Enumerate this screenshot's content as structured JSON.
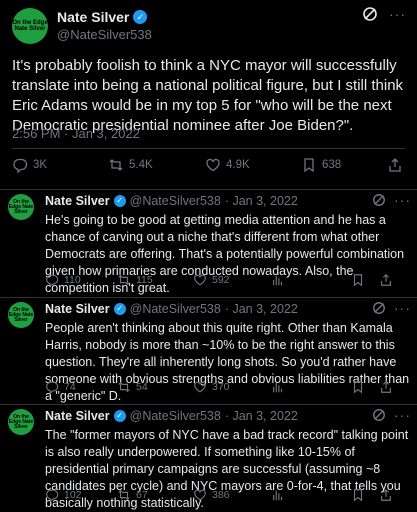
{
  "main_tweet": {
    "author_name": "Nate Silver",
    "author_handle": "@NateSilver538",
    "avatar_text": "On the Edge Nate Silver",
    "text": "It's probably foolish to think a NYC mayor will successfully translate into being a national political figure, but I still think Eric Adams would be in my top 5 for \"who will be the next Democratic presidential nominee after Joe Biden?\".",
    "timestamp": "2:56 PM · Jan 3, 2022",
    "replies": "3K",
    "reposts": "5.4K",
    "likes": "4.9K",
    "bookmarks": "638"
  },
  "replies": [
    {
      "author_name": "Nate Silver",
      "author_handle": "@NateSilver538",
      "date": "· Jan 3, 2022",
      "text": "He's going to be good at getting media attention and he has a chance of carving out a niche that's different from what other Democrats are offering. That's a potentially powerful combination given how primaries are conducted nowadays. Also, the competition isn't great.",
      "replies": "110",
      "reposts": "115",
      "likes": "592"
    },
    {
      "author_name": "Nate Silver",
      "author_handle": "@NateSilver538",
      "date": "· Jan 3, 2022",
      "text": "People aren't thinking about this quite right. Other than Kamala Harris, nobody is more than ~10% to be the right answer to this question. They're all inherently long shots. So you'd rather have someone with obvious strengths and obvious liabilities rather than a \"generic\" D.",
      "replies": "74",
      "reposts": "54",
      "likes": "370"
    },
    {
      "author_name": "Nate Silver",
      "author_handle": "@NateSilver538",
      "date": "· Jan 3, 2022",
      "text": "The \"former mayors of NYC have a bad track record\" talking point is also really underpowered. If something like 10-15% of presidential primary campaigns are successful (assuming ~8 candidates per cycle) and NYC mayors are 0-for-4, that tells you basically nothing statistically.",
      "replies": "102",
      "reposts": "67",
      "likes": "386"
    }
  ],
  "icons": {
    "verified": "check-badge",
    "grok": "slash-circle",
    "more": "ellipsis"
  },
  "colors": {
    "background": "#000000",
    "text": "#e7e9ea",
    "muted": "#71767b",
    "verified": "#1d9bf0",
    "avatar": "#1f9f3f",
    "divider": "#2f3336"
  }
}
